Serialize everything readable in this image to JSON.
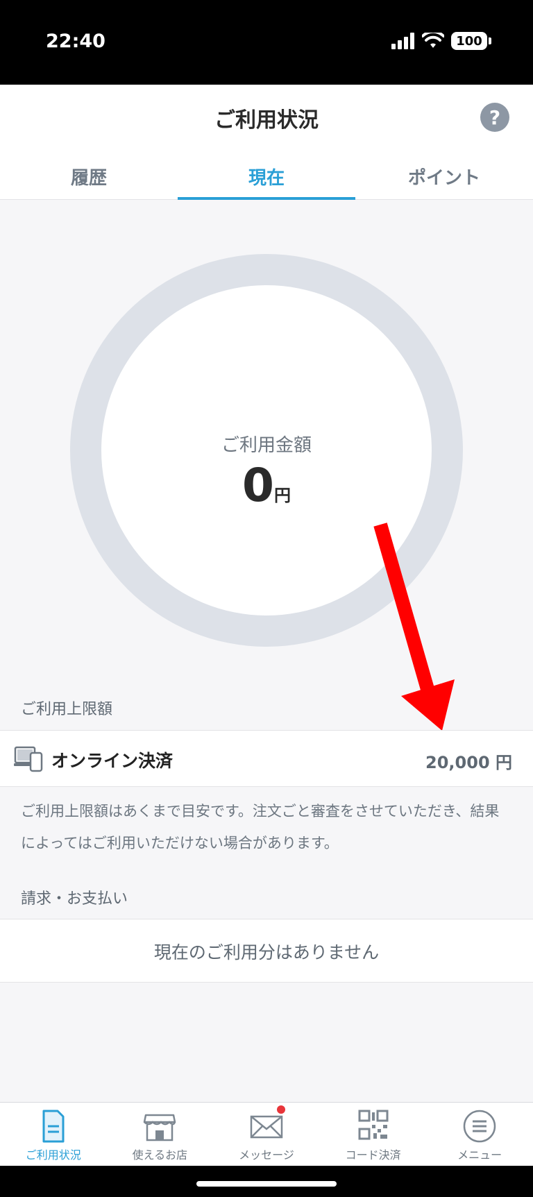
{
  "status_bar": {
    "time": "22:40",
    "battery": "100"
  },
  "header": {
    "title": "ご利用状況",
    "help_label": "?",
    "tabs": [
      {
        "label": "履歴",
        "active": false
      },
      {
        "label": "現在",
        "active": true
      },
      {
        "label": "ポイント",
        "active": false
      }
    ]
  },
  "usage": {
    "label": "ご利用金額",
    "amount": "0",
    "unit": "円",
    "progress_fraction": 0
  },
  "limit_section": {
    "label": "ご利用上限額",
    "rows": [
      {
        "icon": "devices-icon",
        "name": "オンライン決済",
        "value": "20,000 円"
      }
    ],
    "notice": "ご利用上限額はあくまで目安です。注文ごと審査をさせていただき、結果によってはご利用いただけない場合があります。"
  },
  "billing_section": {
    "label": "請求・お支払い",
    "empty_message": "現在のご利用分はありません"
  },
  "bottom_nav": [
    {
      "label": "ご利用状況",
      "icon": "document-icon",
      "active": true
    },
    {
      "label": "使えるお店",
      "icon": "store-icon",
      "active": false
    },
    {
      "label": "メッセージ",
      "icon": "envelope-icon",
      "active": false,
      "badge": true
    },
    {
      "label": "コード決済",
      "icon": "qr-code-icon",
      "active": false
    },
    {
      "label": "メニュー",
      "icon": "menu-icon",
      "active": false
    }
  ],
  "colors": {
    "accent": "#2a9fd6",
    "ring": "#dde1e8",
    "arrow": "#ff0000",
    "badge": "#e8353a"
  }
}
